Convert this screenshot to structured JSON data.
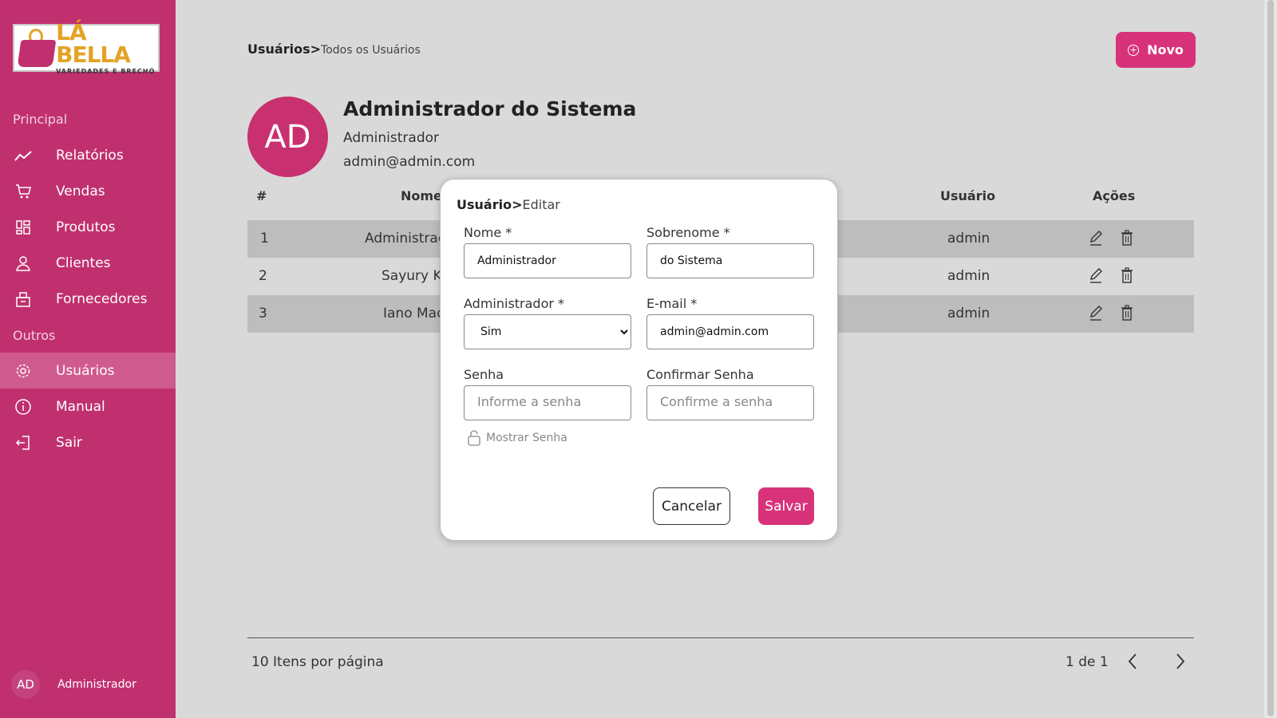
{
  "logo": {
    "brand": "LÁ BELLA",
    "tagline": "VARIEDADES E BRECHÓ"
  },
  "sidebar": {
    "section_principal": "Principal",
    "section_outros": "Outros",
    "items": [
      {
        "label": "Relatórios",
        "icon": "chart-line-icon"
      },
      {
        "label": "Vendas",
        "icon": "cart-icon"
      },
      {
        "label": "Produtos",
        "icon": "products-grid-icon"
      },
      {
        "label": "Clientes",
        "icon": "person-icon"
      },
      {
        "label": "Fornecedores",
        "icon": "supplier-building-icon"
      },
      {
        "label": "Usuários",
        "icon": "gear-icon",
        "active": true
      },
      {
        "label": "Manual",
        "icon": "info-icon"
      },
      {
        "label": "Sair",
        "icon": "logout-icon"
      }
    ],
    "user": {
      "initials": "AD",
      "name": "Administrador"
    }
  },
  "header": {
    "breadcrumb_root": "Usuários>",
    "breadcrumb_current": "Todos os Usuários",
    "new_button": "Novo"
  },
  "profile": {
    "initials": "AD",
    "name": "Administrador do Sistema",
    "role": "Administrador",
    "email": "admin@admin.com"
  },
  "table": {
    "columns": [
      "#",
      "Nome",
      "Usuário",
      "Ações"
    ],
    "rows": [
      {
        "id": "1",
        "name": "Administrac",
        "user": "admin"
      },
      {
        "id": "2",
        "name": "Sayury Ko",
        "user": "admin"
      },
      {
        "id": "3",
        "name": "Iano Mac",
        "user": "admin"
      }
    ]
  },
  "pagination": {
    "per_page": "10 Itens por página",
    "page_of": "1 de 1"
  },
  "modal": {
    "title_root": "Usuário>",
    "title_action": "Editar",
    "fields": {
      "nome_label": "Nome *",
      "nome_value": "Administrador",
      "sobrenome_label": "Sobrenome *",
      "sobrenome_value": "do Sistema",
      "admin_label": "Administrador *",
      "admin_value": "Sim",
      "email_label": "E-mail *",
      "email_value": "admin@admin.com",
      "senha_label": "Senha",
      "senha_placeholder": "Informe a senha",
      "confirmar_label": "Confirmar Senha",
      "confirmar_placeholder": "Confirme a senha"
    },
    "show_password": "Mostrar Senha",
    "cancel_button": "Cancelar",
    "save_button": "Salvar"
  },
  "colors": {
    "brand": "#c0306f",
    "accent": "#d8337a",
    "gold": "#e3a326"
  }
}
